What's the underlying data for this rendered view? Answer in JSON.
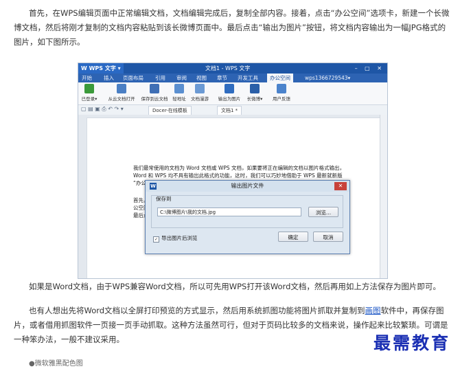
{
  "paragraphs": {
    "p1": "首先，在WPS编辑页面中正常编辑文档，文档编辑完成后，复制全部内容。接着，点击“办公空间”选项卡，新建一个长微博文档，然后将刚才复制的文档内容粘贴到该长微博页面中。最后点击“输出为图片”按钮，将文档内容输出为一幅JPG格式的图片，如下图所示。",
    "p2": "如果是Word文档，由于WPS兼容Word文档，所以可先用WPS打开该Word文档，然后再用如上方法保存为图片即可。",
    "p3_before": "也有人想出先将Word文档以全屏打印预览的方式显示，然后用系统抓图功能将图片抓取并复制到",
    "p3_link": "画图",
    "p3_after": "软件中，再保存图片，或者借用抓图软件一页接一页手动抓取。这种方法虽然可行，但对于页码比较多的文档来说，操作起来比较繁琐。可谓是一种笨办法，一般不建议采用。",
    "p4_partial": "●微软雅黑配色图"
  },
  "screenshot": {
    "app_button": "W WPS 文字 ▾",
    "window_title": "文档1 - WPS 文字",
    "window_controls": "– ▢ ✕",
    "menu": [
      "开始",
      "插入",
      "页面布局",
      "引用",
      "审阅",
      "视图",
      "章节",
      "开发工具",
      "办公空间"
    ],
    "menu_right": "wps1366729543▾",
    "ribbon": [
      "已登录▾",
      "从云文档打开",
      "保存到云文档",
      "轻地址",
      "文档漫游",
      "输出为图片",
      "长微博▾",
      "用户反馈"
    ],
    "tabs": [
      "Docer-在线模板",
      "文档1 *"
    ],
    "doc_lines": [
      "我们最常使用的文档为 Word 文档或 WPS 文档，如果要将正在编辑的文档以图片格式输出，",
      "Word 和 WPS 均不具有输出此格式的功能，这时，我们可以巧妙地借助于 WPS 最新就新版",
      "“办公"
    ],
    "doc_lines_lower": [
      "首先，",
      "公空间",
      "最后点"
    ],
    "dialog": {
      "title": "输出图片文件",
      "group_label": "保存到",
      "path": "C:\\微博图片\\我的文档.jpg",
      "browse": "浏览...",
      "checkbox": "导出图片后浏览",
      "checkbox_mark": "✓",
      "ok": "确定",
      "cancel": "取消"
    }
  },
  "watermark": "最需教育",
  "colors": {
    "title_blue": "#1e56a6",
    "link": "#1a55c5",
    "watermark": "#1a2fb3"
  }
}
